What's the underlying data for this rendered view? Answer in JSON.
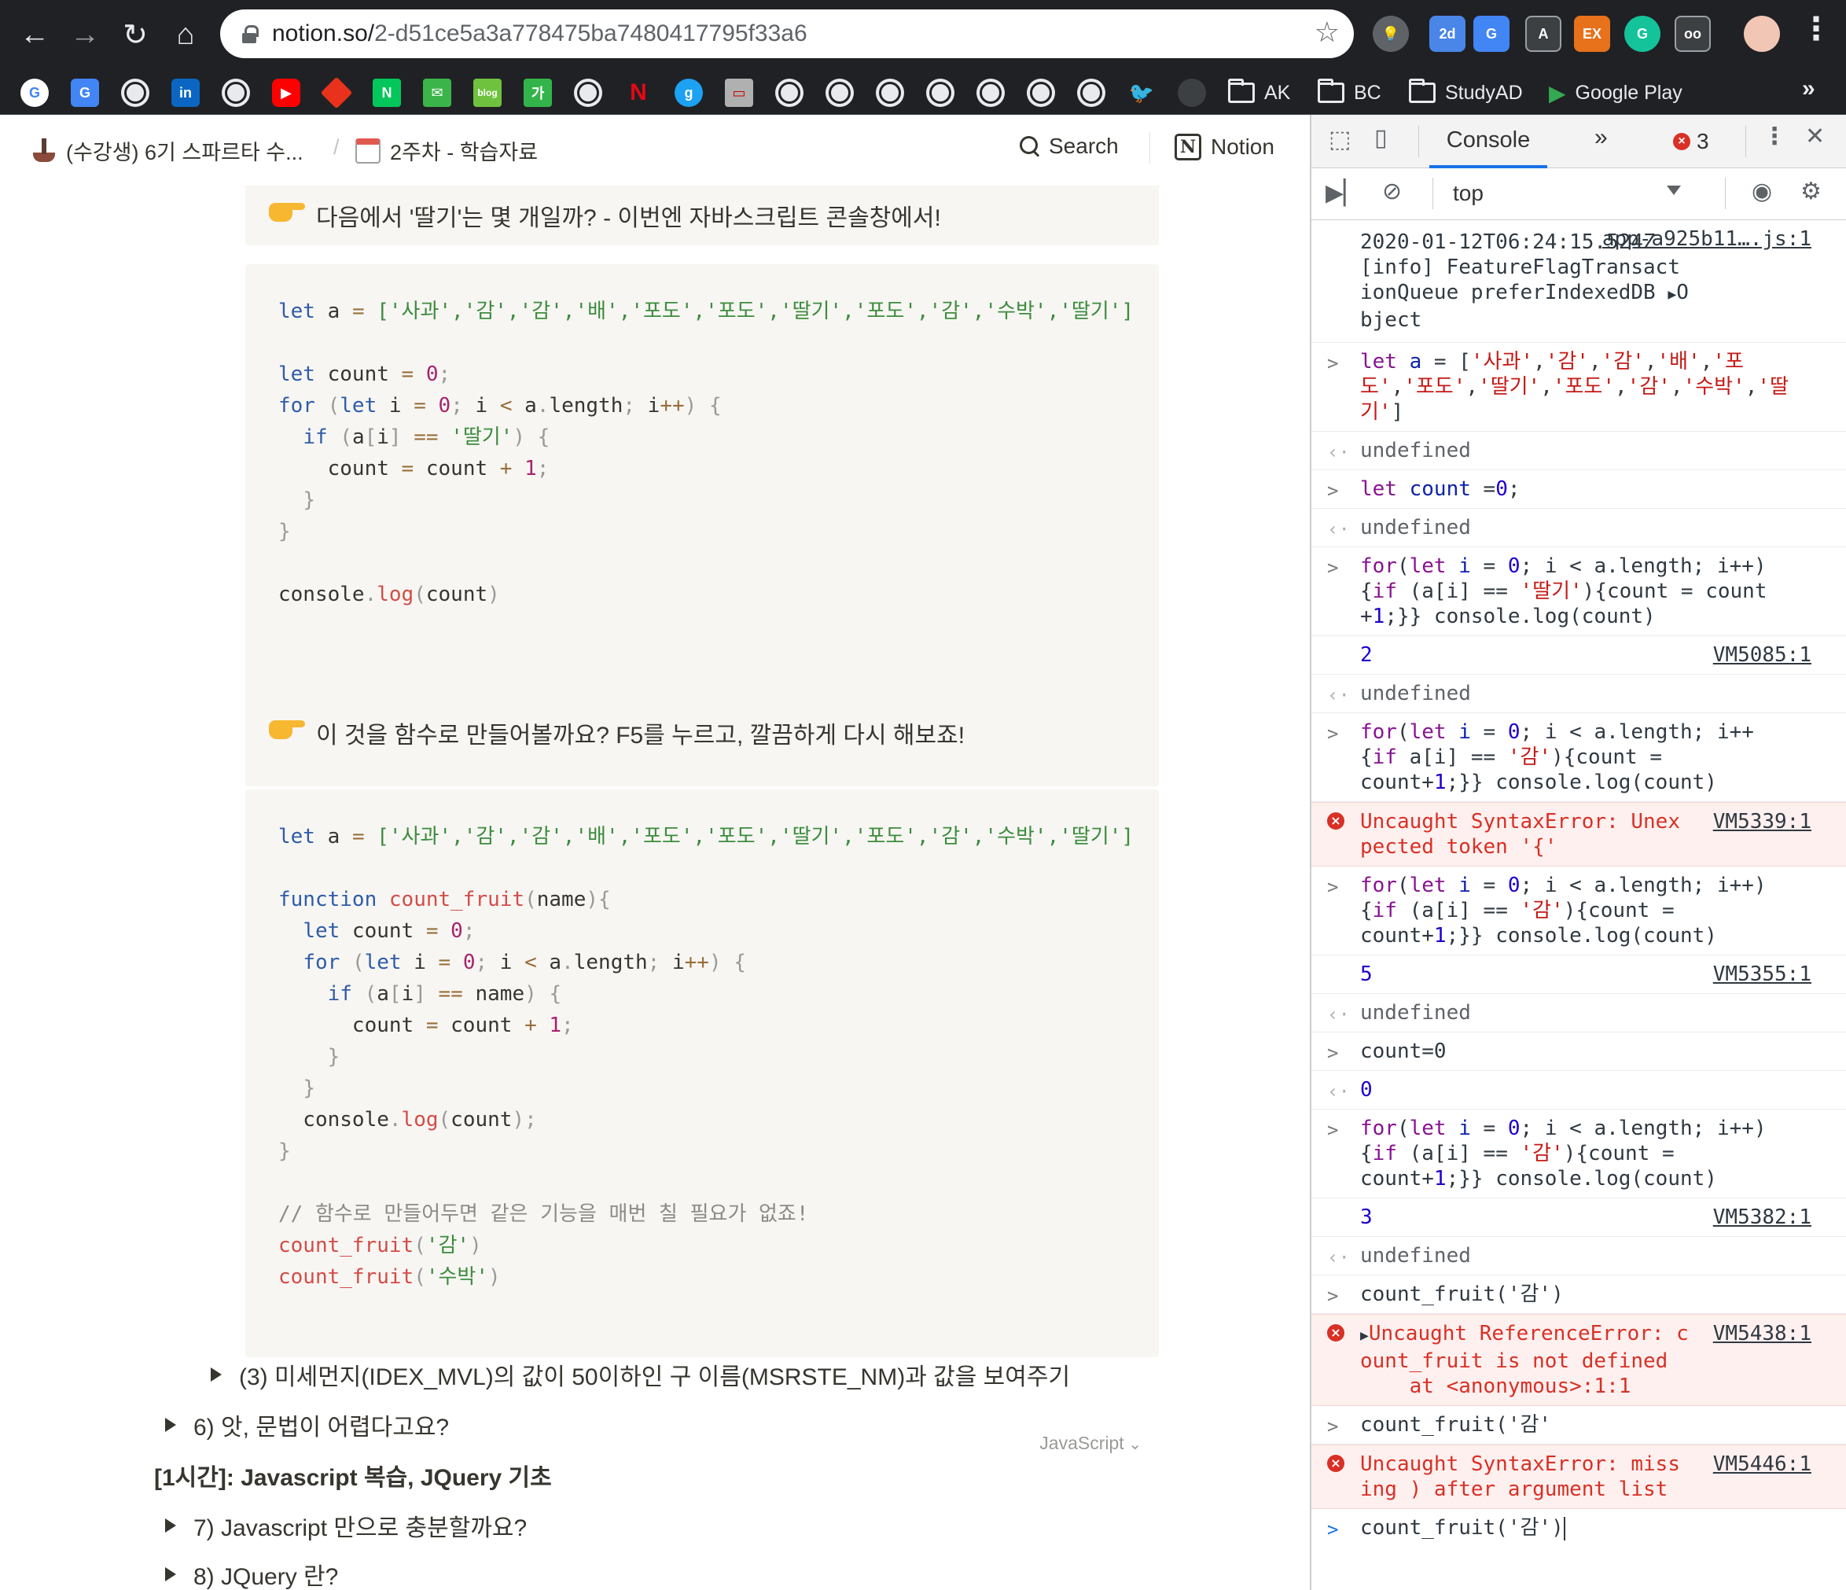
{
  "browser": {
    "url_host": "notion.so/",
    "url_path": "2-d51ce5a3a778475ba7480417795f33a6",
    "bookmarks": {
      "folders": [
        "AK",
        "BC",
        "StudyAD",
        "Google Play"
      ]
    }
  },
  "notion": {
    "breadcrumb": {
      "workspace": "(수강생) 6기 스파르타 수...",
      "separator": "/",
      "page": "2주차 - 학습자료"
    },
    "topbar": {
      "search": "Search",
      "notion": "Notion"
    },
    "callouts": [
      "다음에서 '딸기'는 몇 개일까? - 이번엔 자바스크립트 콘솔창에서!",
      "이 것을 함수로 만들어볼까요? F5를 누르고, 깔끔하게 다시 해보죠!"
    ],
    "code_language": "JavaScript",
    "code1": {
      "arr": "['사과','감','감','배','포도','포도','딸기','포도','감','수박','딸기']",
      "strawberry": "'딸기'"
    },
    "code2": {
      "arr": "['사과','감','감','배','포도','포도','딸기','포도','감','수박','딸기']",
      "comment": "// 함수로 만들어두면 같은 기능을 매번 칠 필요가 없죠!",
      "call1_arg": "'감'",
      "call2_arg": "'수박'"
    },
    "toggles": [
      "(3) 미세먼지(IDEX_MVL)의 값이 50이하인 구 이름(MSRSTE_NM)과 값을 보여주기",
      "6) 앗, 문법이 어렵다고요?",
      "7) Javascript 만으로 충분할까요?",
      "8) JQuery 란?"
    ],
    "heading": "[1시간]: Javascript 복습, JQuery 기초"
  },
  "devtools": {
    "tab": "Console",
    "error_count": "3",
    "context": "top",
    "log_info": {
      "text": "2020-01-12T06:24:15.524Z [info] FeatureFlagTransactionQueue preferIndexedDB",
      "object": "Object",
      "source": "app-a925b11….js:1"
    },
    "undefined": "undefined",
    "results": {
      "r1": "2",
      "r1_src": "VM5085:1",
      "r2": "5",
      "r2_src": "VM5355:1",
      "r3": "0",
      "r4": "3",
      "r4_src": "VM5382:1"
    },
    "errors": {
      "e1_src": "VM5339:1",
      "e1_msg": "Uncaught SyntaxError: Unexpected token '{'",
      "e2_src": "VM5438:1",
      "e2_msg": "Uncaught ReferenceError: count_fruit is not defined",
      "e2_trace": "    at <anonymous>:1:1",
      "e3_src": "VM5446:1",
      "e3_msg": "Uncaught SyntaxError: missing ) after argument list"
    },
    "inputs": {
      "count_reset": "count=0",
      "call_ok": "count_fruit('감')",
      "call_bad": "count_fruit('감'",
      "prompt": "count_fruit('감')"
    }
  },
  "colors": {
    "chrome_bg": "#202124",
    "notion_block_bg": "#f7f6f3",
    "devtools_error_bg": "#fef0ef",
    "devtools_error_text": "#d93025",
    "accent": "#1a73e8"
  }
}
